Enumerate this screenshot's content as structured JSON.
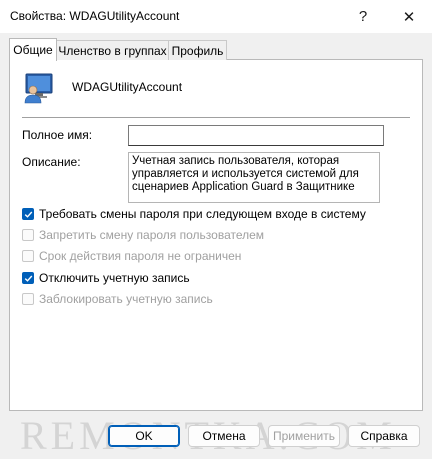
{
  "window": {
    "title": "Свойства: WDAGUtilityAccount",
    "help_glyph": "?",
    "close_glyph": "✕"
  },
  "tabs": [
    {
      "label": "Общие"
    },
    {
      "label": "Членство в группах"
    },
    {
      "label": "Профиль"
    }
  ],
  "general": {
    "account_name": "WDAGUtilityAccount",
    "full_name_label": "Полное имя:",
    "full_name_value": "",
    "description_label": "Описание:",
    "description_value": "Учетная запись пользователя, которая управляется и используется системой для сценариев Application Guard в Защитнике"
  },
  "checkboxes": [
    {
      "label": "Требовать смены пароля при следующем входе в систему",
      "checked": true,
      "enabled": true
    },
    {
      "label": "Запретить смену пароля пользователем",
      "checked": false,
      "enabled": false
    },
    {
      "label": "Срок действия пароля не ограничен",
      "checked": false,
      "enabled": false
    },
    {
      "label": "Отключить учетную запись",
      "checked": true,
      "enabled": true
    },
    {
      "label": "Заблокировать учетную запись",
      "checked": false,
      "enabled": false
    }
  ],
  "buttons": {
    "ok": "OK",
    "cancel": "Отмена",
    "apply": "Применить",
    "help": "Справка"
  },
  "watermark": "REMONTKA.COM",
  "colors": {
    "accent": "#005fb8",
    "disabled_text": "#a0a0a0"
  }
}
